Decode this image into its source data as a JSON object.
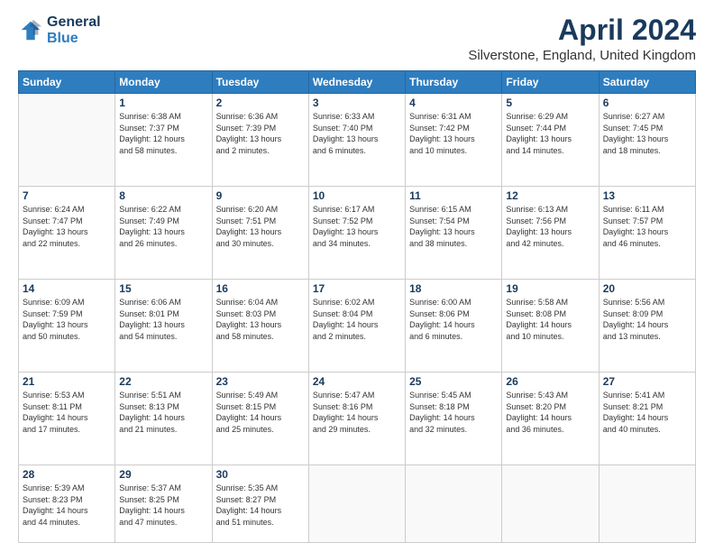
{
  "header": {
    "logo_line1": "General",
    "logo_line2": "Blue",
    "title": "April 2024",
    "subtitle": "Silverstone, England, United Kingdom"
  },
  "days_of_week": [
    "Sunday",
    "Monday",
    "Tuesday",
    "Wednesday",
    "Thursday",
    "Friday",
    "Saturday"
  ],
  "weeks": [
    [
      {
        "day": "",
        "info": ""
      },
      {
        "day": "1",
        "info": "Sunrise: 6:38 AM\nSunset: 7:37 PM\nDaylight: 12 hours\nand 58 minutes."
      },
      {
        "day": "2",
        "info": "Sunrise: 6:36 AM\nSunset: 7:39 PM\nDaylight: 13 hours\nand 2 minutes."
      },
      {
        "day": "3",
        "info": "Sunrise: 6:33 AM\nSunset: 7:40 PM\nDaylight: 13 hours\nand 6 minutes."
      },
      {
        "day": "4",
        "info": "Sunrise: 6:31 AM\nSunset: 7:42 PM\nDaylight: 13 hours\nand 10 minutes."
      },
      {
        "day": "5",
        "info": "Sunrise: 6:29 AM\nSunset: 7:44 PM\nDaylight: 13 hours\nand 14 minutes."
      },
      {
        "day": "6",
        "info": "Sunrise: 6:27 AM\nSunset: 7:45 PM\nDaylight: 13 hours\nand 18 minutes."
      }
    ],
    [
      {
        "day": "7",
        "info": "Sunrise: 6:24 AM\nSunset: 7:47 PM\nDaylight: 13 hours\nand 22 minutes."
      },
      {
        "day": "8",
        "info": "Sunrise: 6:22 AM\nSunset: 7:49 PM\nDaylight: 13 hours\nand 26 minutes."
      },
      {
        "day": "9",
        "info": "Sunrise: 6:20 AM\nSunset: 7:51 PM\nDaylight: 13 hours\nand 30 minutes."
      },
      {
        "day": "10",
        "info": "Sunrise: 6:17 AM\nSunset: 7:52 PM\nDaylight: 13 hours\nand 34 minutes."
      },
      {
        "day": "11",
        "info": "Sunrise: 6:15 AM\nSunset: 7:54 PM\nDaylight: 13 hours\nand 38 minutes."
      },
      {
        "day": "12",
        "info": "Sunrise: 6:13 AM\nSunset: 7:56 PM\nDaylight: 13 hours\nand 42 minutes."
      },
      {
        "day": "13",
        "info": "Sunrise: 6:11 AM\nSunset: 7:57 PM\nDaylight: 13 hours\nand 46 minutes."
      }
    ],
    [
      {
        "day": "14",
        "info": "Sunrise: 6:09 AM\nSunset: 7:59 PM\nDaylight: 13 hours\nand 50 minutes."
      },
      {
        "day": "15",
        "info": "Sunrise: 6:06 AM\nSunset: 8:01 PM\nDaylight: 13 hours\nand 54 minutes."
      },
      {
        "day": "16",
        "info": "Sunrise: 6:04 AM\nSunset: 8:03 PM\nDaylight: 13 hours\nand 58 minutes."
      },
      {
        "day": "17",
        "info": "Sunrise: 6:02 AM\nSunset: 8:04 PM\nDaylight: 14 hours\nand 2 minutes."
      },
      {
        "day": "18",
        "info": "Sunrise: 6:00 AM\nSunset: 8:06 PM\nDaylight: 14 hours\nand 6 minutes."
      },
      {
        "day": "19",
        "info": "Sunrise: 5:58 AM\nSunset: 8:08 PM\nDaylight: 14 hours\nand 10 minutes."
      },
      {
        "day": "20",
        "info": "Sunrise: 5:56 AM\nSunset: 8:09 PM\nDaylight: 14 hours\nand 13 minutes."
      }
    ],
    [
      {
        "day": "21",
        "info": "Sunrise: 5:53 AM\nSunset: 8:11 PM\nDaylight: 14 hours\nand 17 minutes."
      },
      {
        "day": "22",
        "info": "Sunrise: 5:51 AM\nSunset: 8:13 PM\nDaylight: 14 hours\nand 21 minutes."
      },
      {
        "day": "23",
        "info": "Sunrise: 5:49 AM\nSunset: 8:15 PM\nDaylight: 14 hours\nand 25 minutes."
      },
      {
        "day": "24",
        "info": "Sunrise: 5:47 AM\nSunset: 8:16 PM\nDaylight: 14 hours\nand 29 minutes."
      },
      {
        "day": "25",
        "info": "Sunrise: 5:45 AM\nSunset: 8:18 PM\nDaylight: 14 hours\nand 32 minutes."
      },
      {
        "day": "26",
        "info": "Sunrise: 5:43 AM\nSunset: 8:20 PM\nDaylight: 14 hours\nand 36 minutes."
      },
      {
        "day": "27",
        "info": "Sunrise: 5:41 AM\nSunset: 8:21 PM\nDaylight: 14 hours\nand 40 minutes."
      }
    ],
    [
      {
        "day": "28",
        "info": "Sunrise: 5:39 AM\nSunset: 8:23 PM\nDaylight: 14 hours\nand 44 minutes."
      },
      {
        "day": "29",
        "info": "Sunrise: 5:37 AM\nSunset: 8:25 PM\nDaylight: 14 hours\nand 47 minutes."
      },
      {
        "day": "30",
        "info": "Sunrise: 5:35 AM\nSunset: 8:27 PM\nDaylight: 14 hours\nand 51 minutes."
      },
      {
        "day": "",
        "info": ""
      },
      {
        "day": "",
        "info": ""
      },
      {
        "day": "",
        "info": ""
      },
      {
        "day": "",
        "info": ""
      }
    ]
  ]
}
